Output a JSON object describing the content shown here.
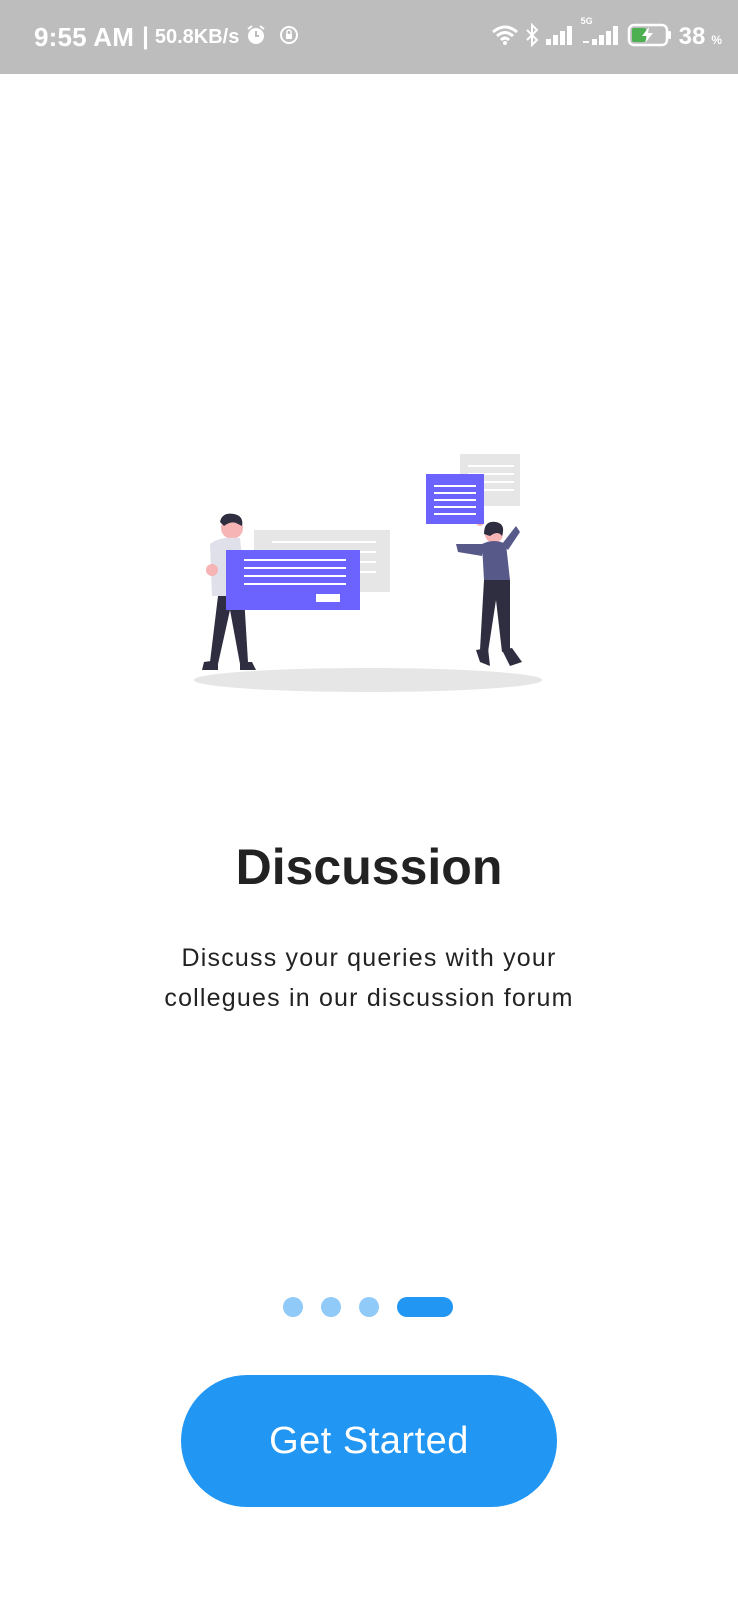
{
  "status_bar": {
    "time": "9:55 AM",
    "separator": "|",
    "network_speed": "50.8KB/s",
    "network_type": "5G",
    "battery_level": "38",
    "battery_unit": "%",
    "icons": [
      "alarm-icon",
      "vpn-icon",
      "wifi-icon",
      "bluetooth-icon",
      "signal-icon",
      "signal-5g-icon",
      "battery-charging-icon"
    ]
  },
  "onboarding": {
    "title": "Discussion",
    "description": "Discuss your queries with your collegues in our discussion forum",
    "page_count": 4,
    "active_page_index": 3
  },
  "cta": {
    "label": "Get Started"
  },
  "colors": {
    "status_bar": "#bdbdbd",
    "accent": "#2196f3",
    "dot_inactive": "#90caf9",
    "illustration_purple": "#6c63ff",
    "text": "#222222"
  }
}
